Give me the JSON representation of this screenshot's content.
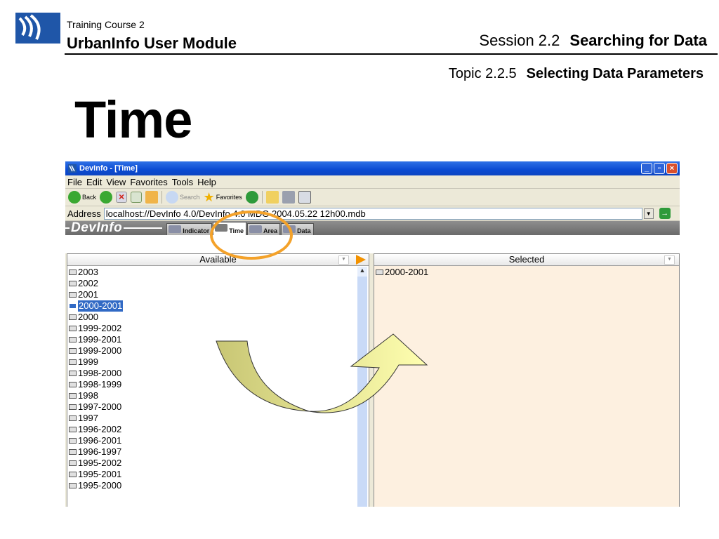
{
  "slide": {
    "course_small": "Training Course 2",
    "course_big": "UrbanInfo User Module",
    "session_num": "Session 2.2",
    "session_title": "Searching for Data",
    "topic_num": "Topic 2.2.5",
    "topic_title": "Selecting Data Parameters",
    "title": "Time"
  },
  "window": {
    "title": "DevInfo - [Time]",
    "menu": [
      "File",
      "Edit",
      "View",
      "Favorites",
      "Tools",
      "Help"
    ],
    "toolbar": {
      "back": "Back",
      "search": "Search",
      "favorites": "Favorites"
    },
    "address_label": "Address",
    "address_value": "localhost://DevInfo 4.0/DevInfo 4.0 MDG 2004.05.22 12h00.mdb",
    "brand": "DevInfo",
    "tabs": [
      {
        "label": "Indicator"
      },
      {
        "label": "Time"
      },
      {
        "label": "Area"
      },
      {
        "label": "Data"
      }
    ]
  },
  "available": {
    "header": "Available",
    "items": [
      "2003",
      "2002",
      "2001",
      "2000-2001",
      "2000",
      "1999-2002",
      "1999-2001",
      "1999-2000",
      "1999",
      "1998-2000",
      "1998-1999",
      "1998",
      "1997-2000",
      "1997",
      "1996-2002",
      "1996-2001",
      "1996-1997",
      "1995-2002",
      "1995-2001",
      "1995-2000"
    ],
    "selected_index": 3
  },
  "selected": {
    "header": "Selected",
    "items": [
      "2000-2001"
    ]
  },
  "colors": {
    "highlight": "#f4a22a",
    "selection": "#316ac5",
    "move_arrow": "#f39200"
  }
}
